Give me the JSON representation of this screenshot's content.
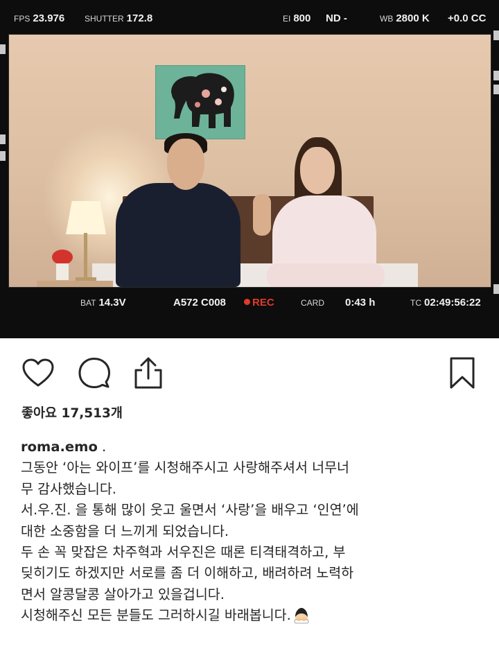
{
  "camera_hud": {
    "fps_label": "FPS",
    "fps_value": "23.976",
    "shutter_label": "SHUTTER",
    "shutter_value": "172.8",
    "ei_label": "EI",
    "ei_value": "800",
    "nd_label": "ND",
    "nd_value": "-",
    "wb_label": "WB",
    "wb_value": "2800 K",
    "cc_value": "+0.0 CC",
    "bat_label": "BAT",
    "bat_value": "14.3V",
    "clip_value": "A572 C008",
    "rec_label": "REC",
    "card_label": "CARD",
    "card_value": "0:43 h",
    "tc_label": "TC",
    "tc_value": "02:49:56:22"
  },
  "post": {
    "likes_text": "좋아요 17,513개",
    "username": "roma.emo",
    "username_suffix": " .",
    "caption_lines": [
      "그동안 ‘아는 와이프’를 시청해주시고 사랑해주셔서 너무너",
      "무 감사했습니다.",
      "서.우.진. 을 통해 많이 웃고 울면서 ‘사랑’을 배우고 ‘인연’에",
      "대한 소중함을 더 느끼게 되었습니다.",
      "두 손 꼭 맞잡은 차주혁과 서우진은 때론 티격태격하고, 부",
      "딪히기도 하겠지만 서로를 좀 더 이해하고, 배려하려 노력하",
      "면서 알콩달콩 살아가고 있을겁니다.",
      "시청해주신 모든 분들도 그러하시길 바래봅니다."
    ]
  },
  "icons": {
    "like": "heart-icon",
    "comment": "comment-icon",
    "share": "share-icon",
    "save": "bookmark-icon",
    "emoji": "person-bowing-emoji"
  },
  "colors": {
    "text": "#262626",
    "rec": "#e23a2a"
  }
}
